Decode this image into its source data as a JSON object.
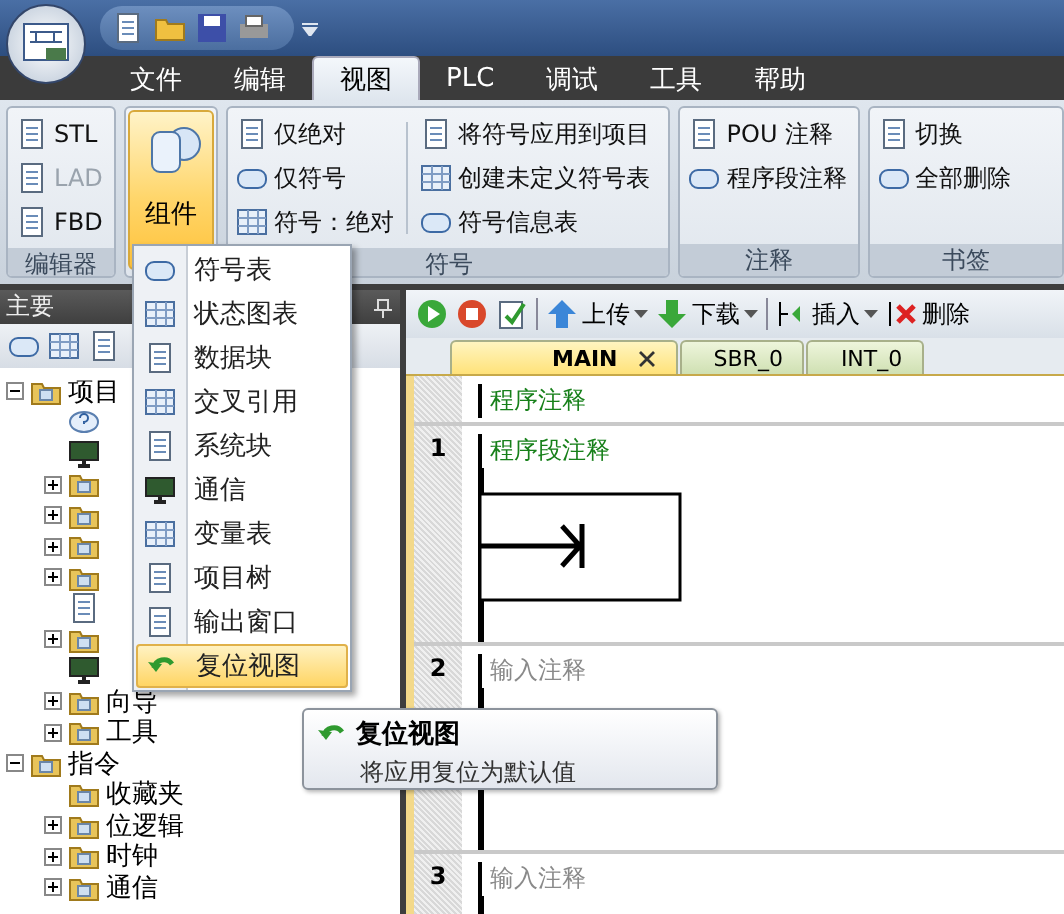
{
  "menu_tabs": [
    {
      "label": "文件",
      "selected": false
    },
    {
      "label": "编辑",
      "selected": false
    },
    {
      "label": "视图",
      "selected": true
    },
    {
      "label": "PLC",
      "selected": false
    },
    {
      "label": "调试",
      "selected": false
    },
    {
      "label": "工具",
      "selected": false
    },
    {
      "label": "帮助",
      "selected": false
    }
  ],
  "ribbon": {
    "groups": [
      {
        "kind": "stack",
        "title": "编辑器",
        "items": [
          {
            "label": "STL",
            "disabled": false
          },
          {
            "label": "LAD",
            "disabled": true
          },
          {
            "label": "FBD",
            "disabled": false
          }
        ]
      },
      {
        "kind": "big",
        "label": "组件",
        "pressed": true
      },
      {
        "kind": "columns",
        "title": "符号",
        "columns": [
          [
            "仅绝对",
            "仅符号",
            "符号：绝对"
          ],
          [
            "将符号应用到项目",
            "创建未定义符号表",
            "符号信息表"
          ]
        ]
      },
      {
        "kind": "columns",
        "title": "注释",
        "columns": [
          [
            "POU 注释",
            "程序段注释"
          ]
        ]
      },
      {
        "kind": "columns",
        "title": "书签",
        "columns": [
          [
            "切换",
            "全部删除"
          ]
        ]
      }
    ]
  },
  "left_panel": {
    "title": "主要",
    "tree": [
      {
        "label": "项目",
        "expanded": true,
        "children": [
          {
            "kind": "help"
          },
          {
            "kind": "cpu"
          },
          {
            "kind": "folder",
            "expanded": false
          },
          {
            "kind": "folder",
            "expanded": false
          },
          {
            "kind": "folder",
            "expanded": false
          },
          {
            "kind": "folder",
            "expanded": false
          },
          {
            "kind": "doc"
          },
          {
            "kind": "folder",
            "expanded": false
          },
          {
            "kind": "cpu"
          },
          {
            "label": "向导",
            "expanded": false
          },
          {
            "label": "工具",
            "expanded": false
          }
        ]
      },
      {
        "label": "指令",
        "expanded": true,
        "children": [
          {
            "label": "收藏夹"
          },
          {
            "label": "位逻辑",
            "expanded": false
          },
          {
            "label": "时钟",
            "expanded": false
          },
          {
            "label": "通信",
            "expanded": false
          }
        ]
      }
    ]
  },
  "editor_toolbar": [
    {
      "kind": "run"
    },
    {
      "kind": "stop"
    },
    {
      "kind": "compile"
    },
    {
      "kind": "sep"
    },
    {
      "kind": "upload",
      "label": "上传"
    },
    {
      "kind": "download",
      "label": "下载"
    },
    {
      "kind": "sep"
    },
    {
      "kind": "insert",
      "label": "插入"
    },
    {
      "kind": "delete",
      "label": "删除"
    }
  ],
  "editor_tabs": [
    {
      "label": "MAIN",
      "selected": true
    },
    {
      "label": "SBR_0",
      "selected": false
    },
    {
      "label": "INT_0",
      "selected": false
    }
  ],
  "program_comment": "程序注释",
  "networks": [
    {
      "number": "1",
      "comment": "程序段注释",
      "kind": "box"
    },
    {
      "number": "2",
      "placeholder": "输入注释",
      "kind": "empty"
    },
    {
      "number": "3",
      "placeholder": "输入注释",
      "kind": "empty"
    }
  ],
  "dropdown_menu": [
    {
      "label": "符号表",
      "selected": false
    },
    {
      "label": "状态图表",
      "selected": false
    },
    {
      "label": "数据块",
      "selected": false
    },
    {
      "label": "交叉引用",
      "selected": false
    },
    {
      "label": "系统块",
      "selected": false
    },
    {
      "label": "通信",
      "selected": false
    },
    {
      "label": "变量表",
      "selected": false
    },
    {
      "label": "项目树",
      "selected": false
    },
    {
      "label": "输出窗口",
      "selected": false
    },
    {
      "label": "复位视图",
      "selected": true
    }
  ],
  "tooltip": {
    "title": "复位视图",
    "text": "将应用复位为默认值"
  }
}
